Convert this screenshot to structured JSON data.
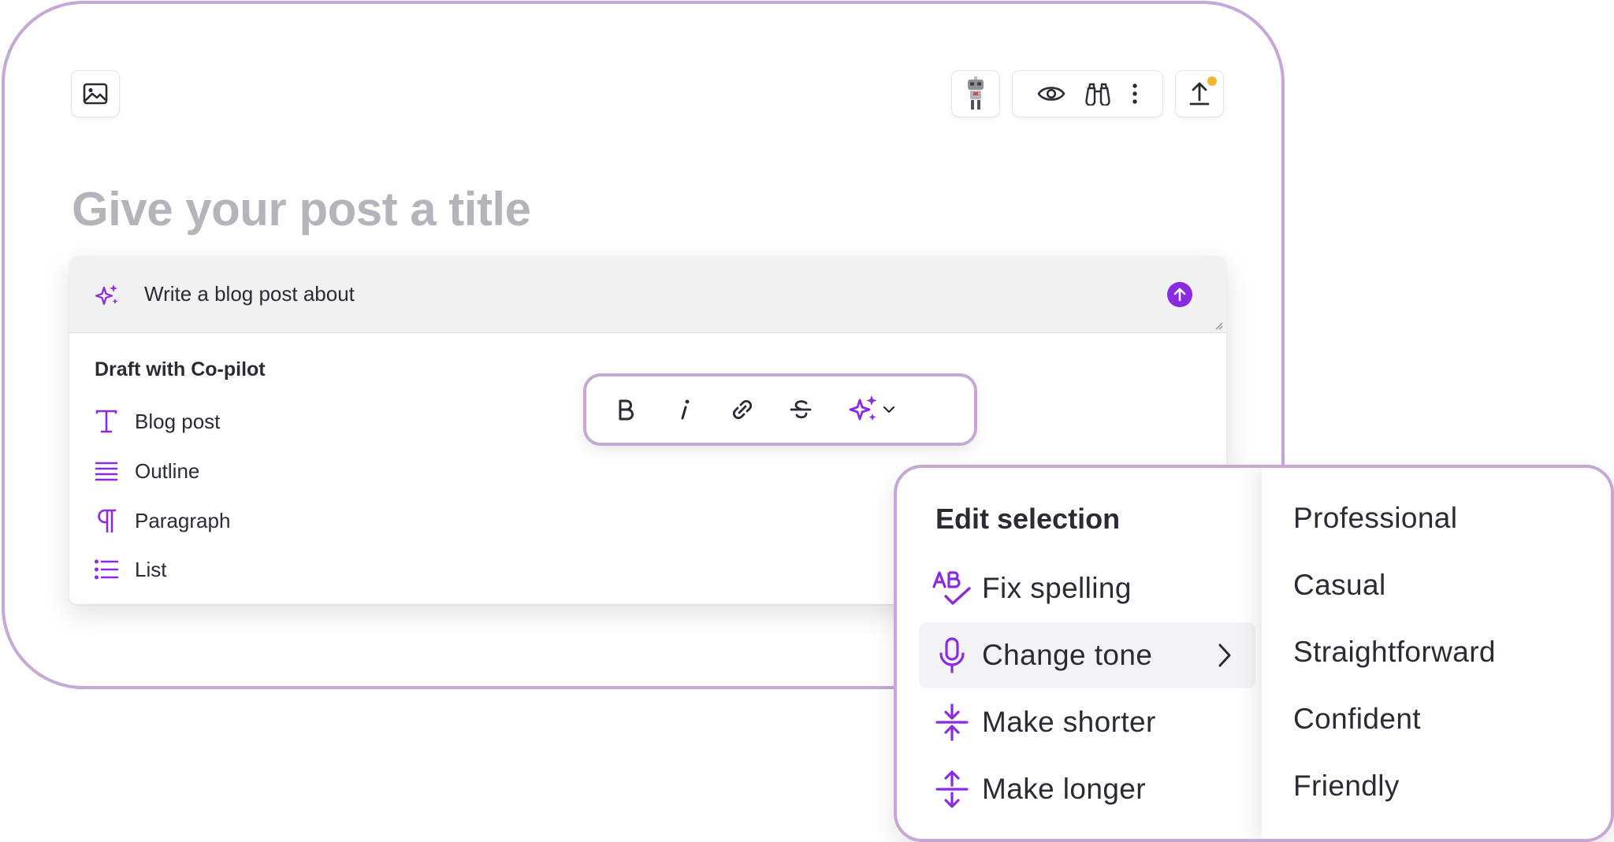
{
  "colors": {
    "accent": "#8a2be2",
    "frame_border": "#c5a8d6",
    "notification": "#f1b52e",
    "title_placeholder": "#b4b4bb"
  },
  "toolbar": {
    "left_icon": "image-icon",
    "avatar_icon": "robot-avatar-icon",
    "group_icons": [
      "eye-icon",
      "binoculars-icon",
      "more-vertical-icon"
    ],
    "publish_icon": "upload-icon"
  },
  "post": {
    "title_placeholder": "Give your post a title"
  },
  "copilot": {
    "prompt_text": "Write a blog post about",
    "draft_heading": "Draft with Co-pilot",
    "draft_items": [
      {
        "label": "Blog post",
        "icon": "text-t-icon"
      },
      {
        "label": "Outline",
        "icon": "lines-icon"
      },
      {
        "label": "Paragraph",
        "icon": "pilcrow-icon"
      },
      {
        "label": "List",
        "icon": "bullet-list-icon"
      }
    ]
  },
  "format_toolbar": {
    "buttons": [
      "bold-icon",
      "italic-icon",
      "link-icon",
      "strikethrough-icon",
      "ai-sparkle-icon",
      "chevron-down-icon"
    ]
  },
  "edit_menu": {
    "heading": "Edit selection",
    "items": [
      {
        "label": "Fix spelling",
        "icon": "spellcheck-icon"
      },
      {
        "label": "Change tone",
        "icon": "microphone-icon",
        "has_submenu": true,
        "active": true
      },
      {
        "label": "Make shorter",
        "icon": "compress-icon"
      },
      {
        "label": "Make longer",
        "icon": "expand-icon"
      }
    ]
  },
  "tone_menu": {
    "items": [
      "Professional",
      "Casual",
      "Straightforward",
      "Confident",
      "Friendly"
    ]
  }
}
